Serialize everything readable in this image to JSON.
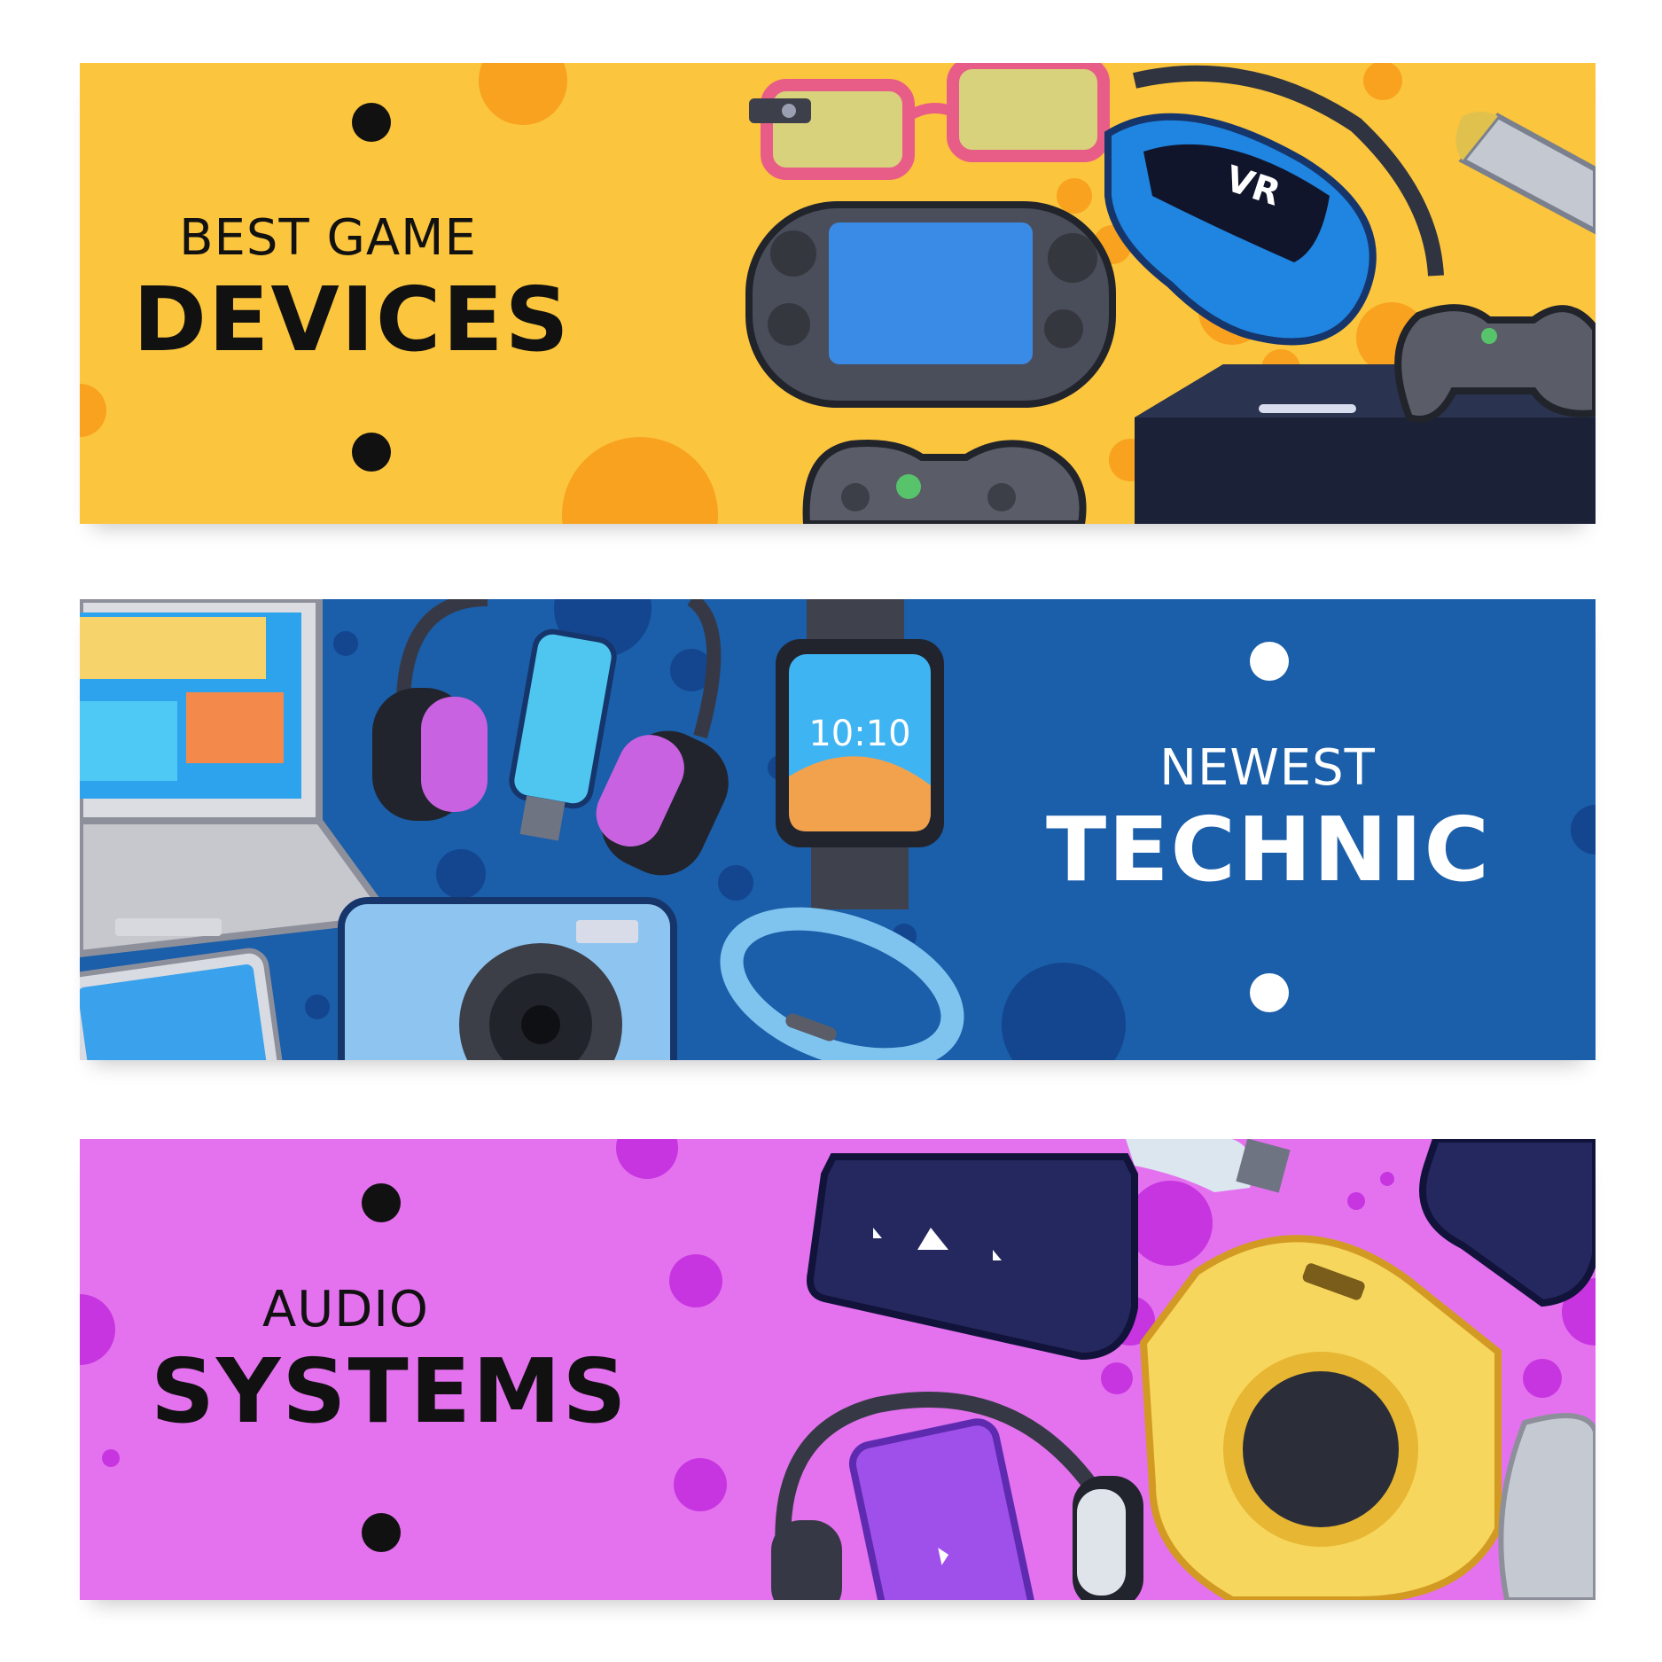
{
  "banners": {
    "games": {
      "small_title": "BEST GAME",
      "big_title": "DEVICES",
      "vr_label": "VR",
      "background_color": "#fbc53d",
      "accent_color": "#f8a21f",
      "text_color": "#111111",
      "icons": [
        "smart-glasses-icon",
        "vr-headset-icon",
        "handheld-console-icon",
        "game-controller-icon",
        "game-console-icon",
        "vr-controller-icon"
      ]
    },
    "tech": {
      "small_title": "NEWEST",
      "big_title": "TECHNIC",
      "watch_time": "10:10",
      "background_color": "#1b5ea9",
      "accent_color": "#14458f",
      "text_color": "#ffffff",
      "icons": [
        "laptop-icon",
        "headphones-icon",
        "usb-flash-drive-icon",
        "smartwatch-icon",
        "camera-icon",
        "fitness-band-icon",
        "tablet-icon"
      ]
    },
    "audio": {
      "small_title": "AUDIO",
      "big_title": "SYSTEMS",
      "background_color": "#e472ef",
      "accent_color": "#c735e0",
      "text_color": "#111111",
      "icons": [
        "media-player-icon",
        "usb-drive-icon",
        "speaker-icon",
        "headphones-icon",
        "music-player-icon"
      ]
    }
  }
}
